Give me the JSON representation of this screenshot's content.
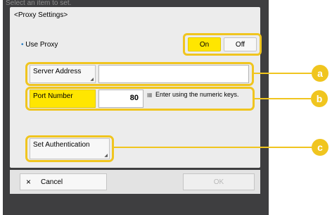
{
  "header": {
    "breadcrumb_text": "Select an item to set."
  },
  "dialog": {
    "title": "<Proxy Settings>",
    "use_proxy": {
      "bullet": "•",
      "label": "Use Proxy",
      "on_label": "On",
      "off_label": "Off",
      "selected": "On"
    },
    "server_address": {
      "label": "Server Address",
      "value": ""
    },
    "port_number": {
      "label": "Port Number",
      "value": "80",
      "hint": "Enter using the numeric keys."
    },
    "set_authentication": {
      "label": "Set Authentication"
    }
  },
  "footer": {
    "cancel_icon": "×",
    "cancel_label": "Cancel",
    "ok_label": "OK"
  },
  "callouts": [
    "a",
    "b",
    "c"
  ],
  "colors": {
    "accent_yellow": "#f0c51f",
    "highlight_yellow": "#ffe600",
    "bullet_blue": "#2a7fc7"
  }
}
